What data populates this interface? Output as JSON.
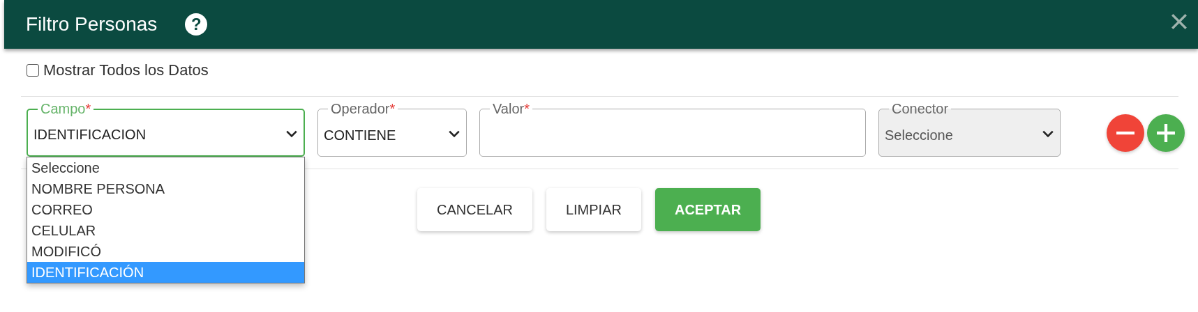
{
  "title": "Filtro Personas",
  "help": "?",
  "show_all": {
    "label": "Mostrar Todos los Datos",
    "checked": false
  },
  "filters": [
    {
      "kind": "select",
      "label": "Campo",
      "required_mark": "*",
      "value": "IDENTIFICACION",
      "focused": true,
      "disabled": false,
      "options": [
        {
          "label": "Seleccione",
          "selected": false
        },
        {
          "label": "NOMBRE PERSONA",
          "selected": false
        },
        {
          "label": "CORREO",
          "selected": false
        },
        {
          "label": "CELULAR",
          "selected": false
        },
        {
          "label": "MODIFICÓ",
          "selected": false
        },
        {
          "label": "IDENTIFICACIÓN",
          "selected": true
        }
      ]
    },
    {
      "kind": "select",
      "label": "Operador",
      "required_mark": "*",
      "value": "CONTIENE",
      "focused": false,
      "disabled": false
    },
    {
      "kind": "text",
      "label": "Valor",
      "required_mark": "*",
      "focused": false,
      "disabled": false
    },
    {
      "kind": "select",
      "label": "Conector",
      "value": "Seleccione",
      "focused": false,
      "disabled": true
    }
  ],
  "buttons": [
    {
      "label": "CANCELAR",
      "kind": "default"
    },
    {
      "label": "LIMPIAR",
      "kind": "default"
    },
    {
      "label": "ACEPTAR",
      "kind": "primary"
    }
  ]
}
